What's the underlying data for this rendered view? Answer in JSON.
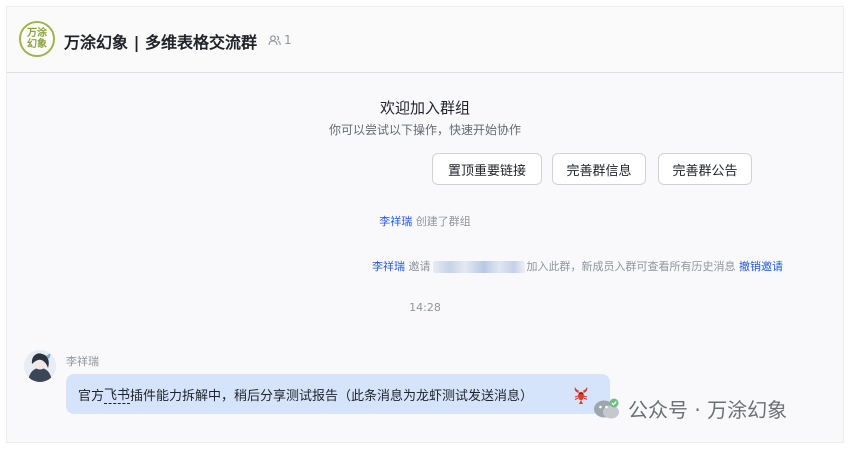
{
  "header": {
    "logo_text": [
      "万涂",
      "幻象"
    ],
    "title": "万涂幻象 | 多维表格交流群",
    "member_count": "1"
  },
  "welcome": {
    "title": "欢迎加入群组",
    "subtitle": "你可以尝试以下操作，快速开始协作",
    "actions": [
      "置顶重要链接",
      "完善群信息",
      "完善群公告"
    ]
  },
  "system": {
    "create": {
      "actor": "李祥瑞",
      "text": "创建了群组"
    },
    "invite": {
      "actor": "李祥瑞",
      "verb": "邀请",
      "text": "加入此群，新成员入群可查看所有历史消息",
      "action": "撤销邀请"
    },
    "time": "14:28"
  },
  "message": {
    "sender": "李祥瑞",
    "text_before": "官方",
    "text_underlined": "飞书",
    "text_after": "插件能力拆解中，稍后分享测试报告（此条消息为龙虾测试发送消息）",
    "reaction_icon": "lobster-icon"
  },
  "watermark": {
    "text": "公众号 · 万涂幻象"
  },
  "colors": {
    "link": "#245bdb",
    "bubble": "#d6e4fb",
    "logo": "#9cb649"
  }
}
